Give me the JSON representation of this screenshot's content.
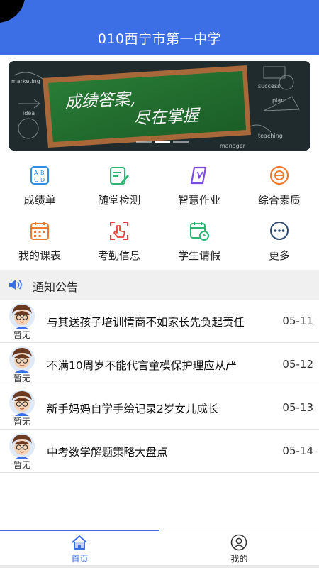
{
  "header": {
    "title": "010西宁市第一中学"
  },
  "banner": {
    "headline_line1": "成绩答案,",
    "headline_line2": "尽在掌握",
    "doodles": [
      "success",
      "plan",
      "teaching",
      "manager",
      "marketing",
      "idea"
    ]
  },
  "grid": [
    {
      "label": "成绩单",
      "icon": "report-card-icon",
      "color": "#2f8de4"
    },
    {
      "label": "随堂检测",
      "icon": "edit-test-icon",
      "color": "#2bb673"
    },
    {
      "label": "智慧作业",
      "icon": "homework-icon",
      "color": "#7b4ce0"
    },
    {
      "label": "综合素质",
      "icon": "quality-icon",
      "color": "#f07b2e"
    },
    {
      "label": "我的课表",
      "icon": "timetable-icon",
      "color": "#f07b2e"
    },
    {
      "label": "考勤信息",
      "icon": "attendance-icon",
      "color": "#e8433b"
    },
    {
      "label": "学生请假",
      "icon": "leave-calendar-icon",
      "color": "#2bb673"
    },
    {
      "label": "更多",
      "icon": "more-icon",
      "color": "#2c4a6e"
    }
  ],
  "notice": {
    "title": "通知公告"
  },
  "notices": [
    {
      "author": "暂无",
      "title": "与其送孩子培训情商不如家长先负起责任",
      "date": "05-11"
    },
    {
      "author": "暂无",
      "title": "不满10周岁不能代言童模保护理应从严",
      "date": "05-12"
    },
    {
      "author": "暂无",
      "title": "新手妈妈自学手绘记录2岁女儿成长",
      "date": "05-13"
    },
    {
      "author": "暂无",
      "title": "中考数学解题策略大盘点",
      "date": "05-14"
    }
  ],
  "tabs": [
    {
      "label": "首页",
      "icon": "home-icon",
      "active": true
    },
    {
      "label": "我的",
      "icon": "user-icon",
      "active": false
    }
  ],
  "colors": {
    "primary": "#3c6ee6",
    "notice_bg": "#f0f0f0"
  }
}
